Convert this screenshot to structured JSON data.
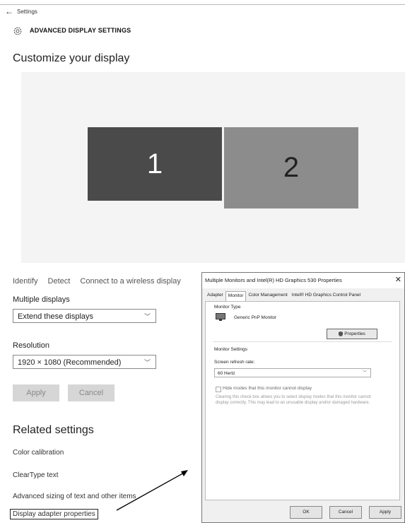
{
  "header": {
    "back_glyph": "←",
    "breadcrumb": "Settings",
    "title": "ADVANCED DISPLAY SETTINGS",
    "gear_icon": "gear-icon"
  },
  "main": {
    "heading": "Customize your display",
    "monitors": [
      {
        "label": "1",
        "color": "#4a4a4a"
      },
      {
        "label": "2",
        "color": "#8c8c8c"
      }
    ],
    "links": [
      "Identify",
      "Detect",
      "Connect to a wireless display"
    ],
    "multiple_displays": {
      "label": "Multiple displays",
      "value": "Extend these displays"
    },
    "resolution": {
      "label": "Resolution",
      "value": "1920 × 1080 (Recommended)"
    },
    "apply_label": "Apply",
    "cancel_label": "Cancel"
  },
  "related": {
    "heading": "Related settings",
    "items": [
      "Color calibration",
      "ClearType text",
      "Advanced sizing of text and other items",
      "Display adapter properties"
    ]
  },
  "dialog": {
    "title": "Multiple Monitors and Intel(R) HD Graphics 530 Properties",
    "close_glyph": "✕",
    "tabs": [
      "Adapter",
      "Monitor",
      "Color Management",
      "Intel® HD Graphics Control Panel"
    ],
    "active_tab": "Monitor",
    "monitor_type_label": "Monitor Type",
    "monitor_name": "Generic PnP Monitor",
    "properties_label": "Properties",
    "monitor_settings_label": "Monitor Settings",
    "refresh_label": "Screen refresh rate:",
    "refresh_value": "60 Hertz",
    "hide_modes_label": "Hide modes that this monitor cannot display",
    "hide_modes_desc": "Clearing this check box allows you to select display modes that this monitor cannot display correctly. This may lead to an unusable display and/or damaged hardware.",
    "ok_label": "OK",
    "cancel_label": "Cancel",
    "apply_label": "Apply"
  }
}
